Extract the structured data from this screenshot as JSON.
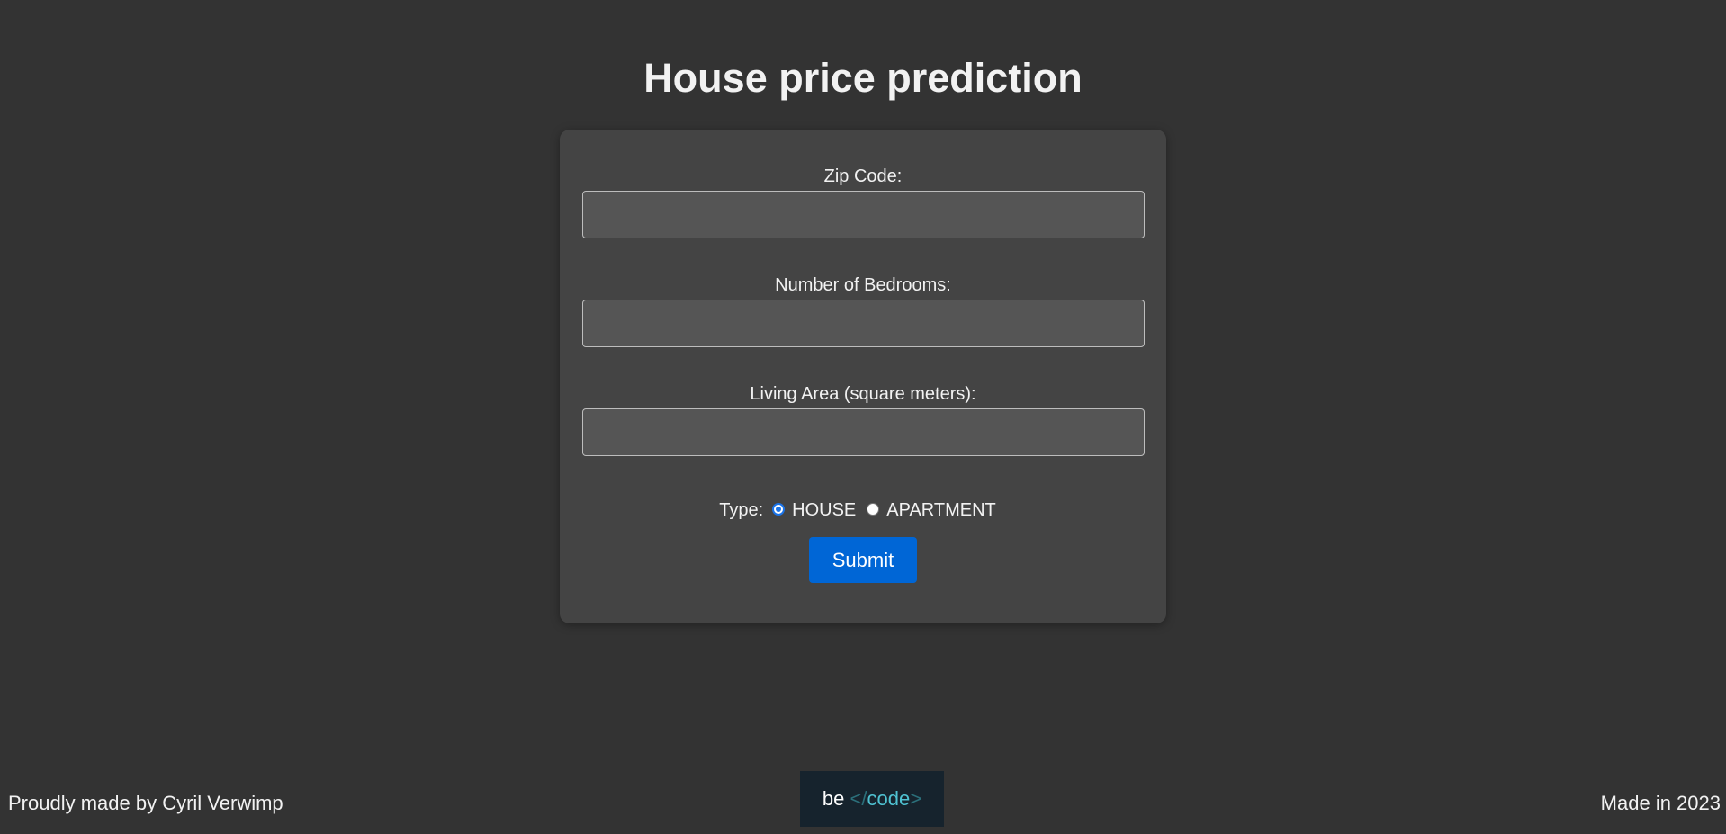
{
  "header": {
    "title": "House price prediction"
  },
  "form": {
    "zip_code": {
      "label": "Zip Code:",
      "value": ""
    },
    "bedrooms": {
      "label": "Number of Bedrooms:",
      "value": ""
    },
    "living_area": {
      "label": "Living Area (square meters):",
      "value": ""
    },
    "type": {
      "label": "Type:",
      "options": [
        "HOUSE",
        "APARTMENT"
      ],
      "selected": "HOUSE"
    },
    "submit_label": "Submit"
  },
  "footer": {
    "left_text": "Proudly made by Cyril Verwimp",
    "right_text": "Made in 2023",
    "logo": {
      "be": "be",
      "open_bracket": "</",
      "code": "code",
      "close_bracket": ">"
    }
  },
  "colors": {
    "background": "#333333",
    "card": "#444444",
    "accent": "#0066d6",
    "logo_accent": "#4fc2d2"
  }
}
